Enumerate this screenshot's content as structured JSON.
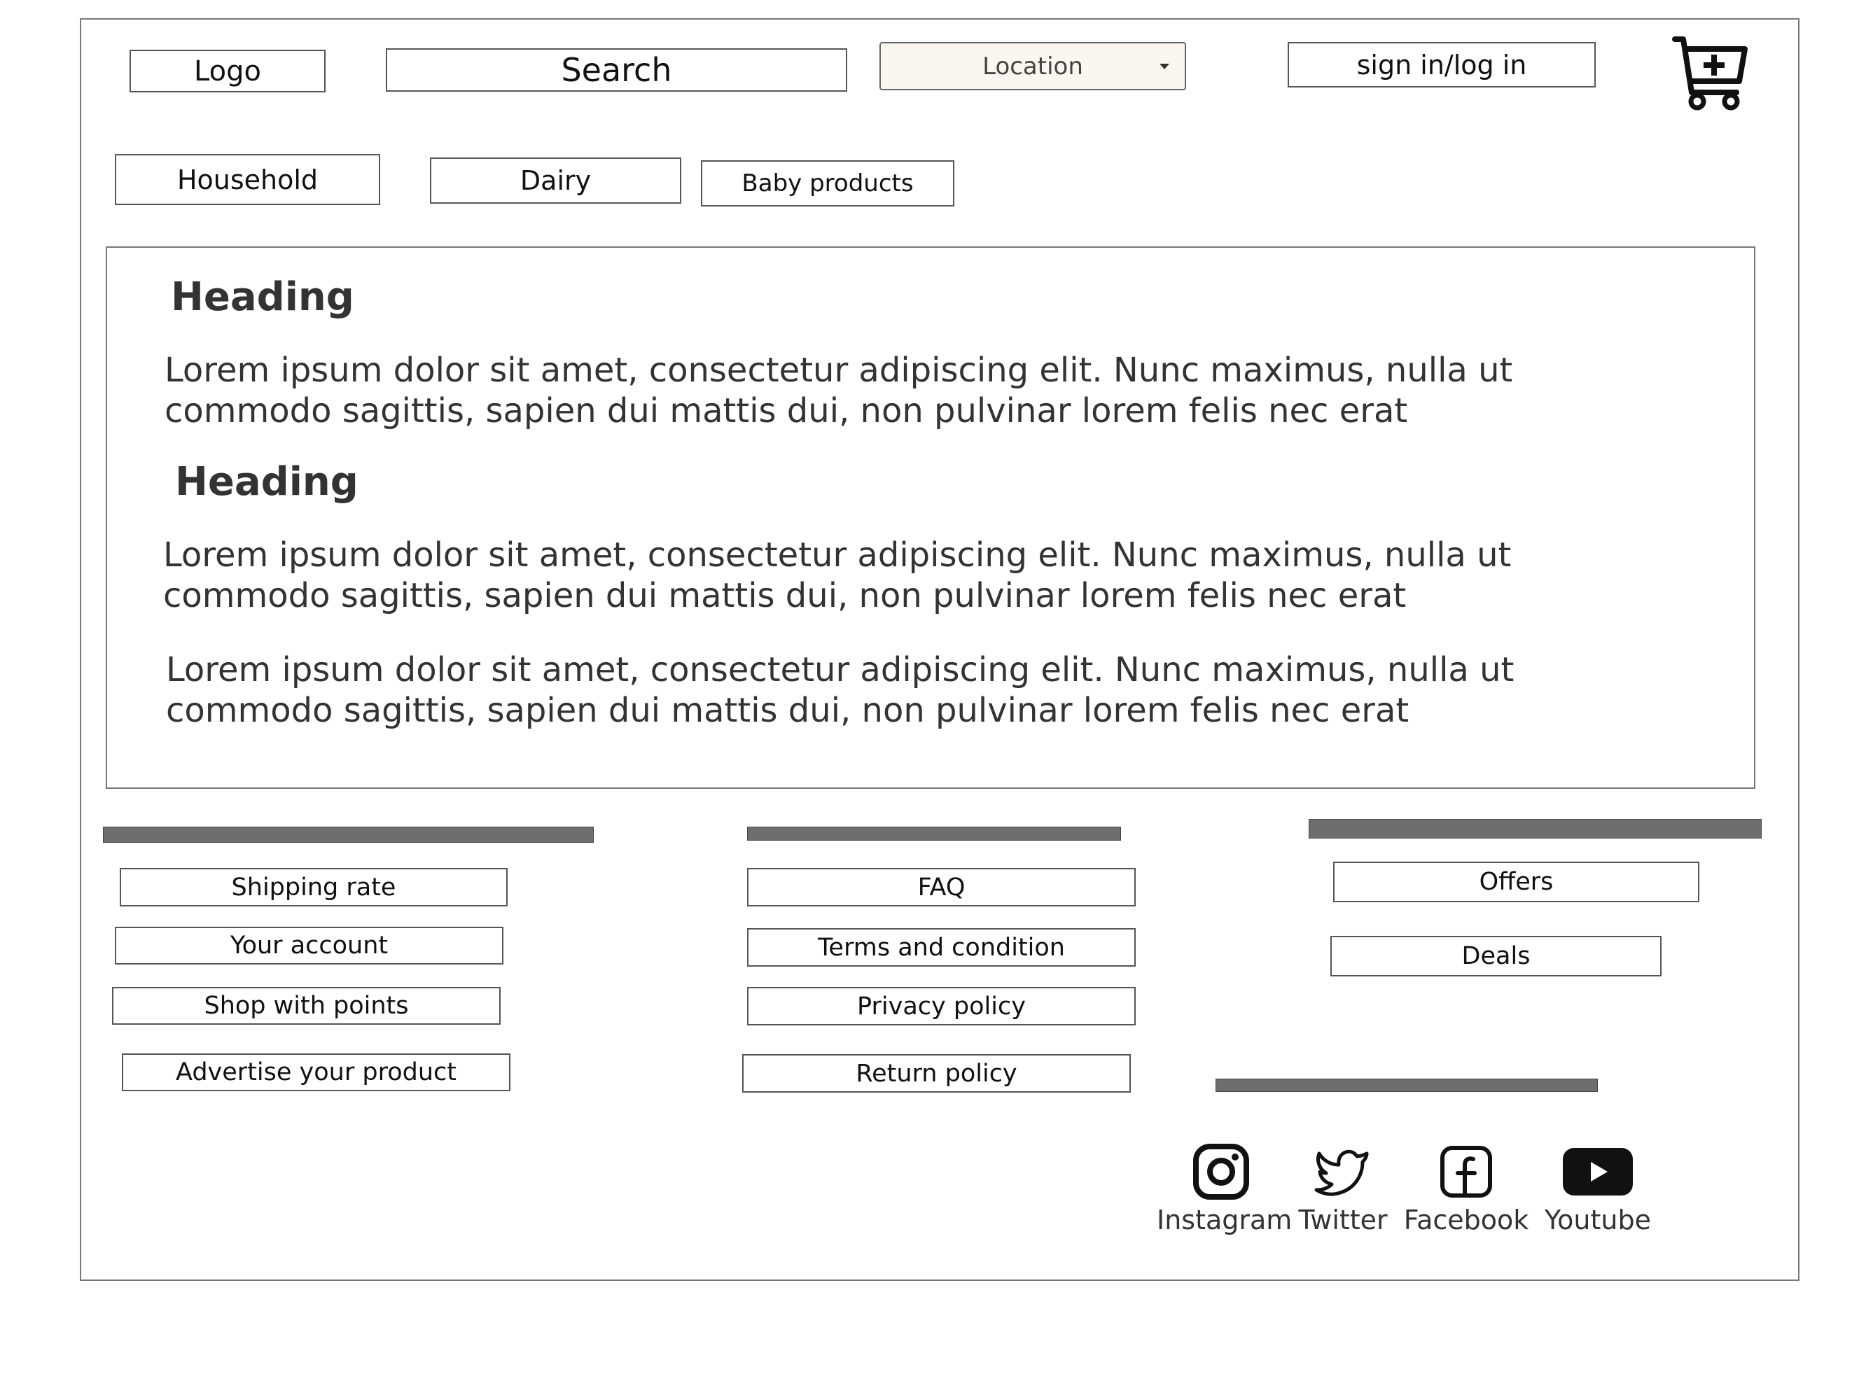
{
  "header": {
    "logo_label": "Logo",
    "search_label": "Search",
    "location_label": "Location",
    "signin_label": "sign in/log in"
  },
  "categories": [
    "Household",
    "Dairy",
    "Baby products"
  ],
  "content": {
    "heading_1": "Heading",
    "paragraph_1": "Lorem ipsum dolor sit amet, consectetur adipiscing elit. Nunc maximus, nulla ut commodo sagittis, sapien dui mattis dui, non pulvinar lorem felis nec erat",
    "heading_2": "Heading",
    "paragraph_2": "Lorem ipsum dolor sit amet, consectetur adipiscing elit. Nunc maximus, nulla ut commodo sagittis, sapien dui mattis dui, non pulvinar lorem felis nec erat",
    "paragraph_3": "Lorem ipsum dolor sit amet, consectetur adipiscing elit. Nunc maximus, nulla ut commodo sagittis, sapien dui mattis dui, non pulvinar lorem felis nec erat"
  },
  "footer": {
    "col1": [
      "Shipping rate",
      "Your account",
      "Shop with points",
      "Advertise your product"
    ],
    "col2": [
      "FAQ",
      "Terms and condition",
      "Privacy policy",
      "Return policy"
    ],
    "col3": [
      "Offers",
      "Deals"
    ],
    "social": [
      {
        "label": "Instagram",
        "icon": "instagram-icon"
      },
      {
        "label": "Twitter",
        "icon": "twitter-icon"
      },
      {
        "label": "Facebook",
        "icon": "facebook-icon"
      },
      {
        "label": "Youtube",
        "icon": "youtube-icon"
      }
    ]
  }
}
